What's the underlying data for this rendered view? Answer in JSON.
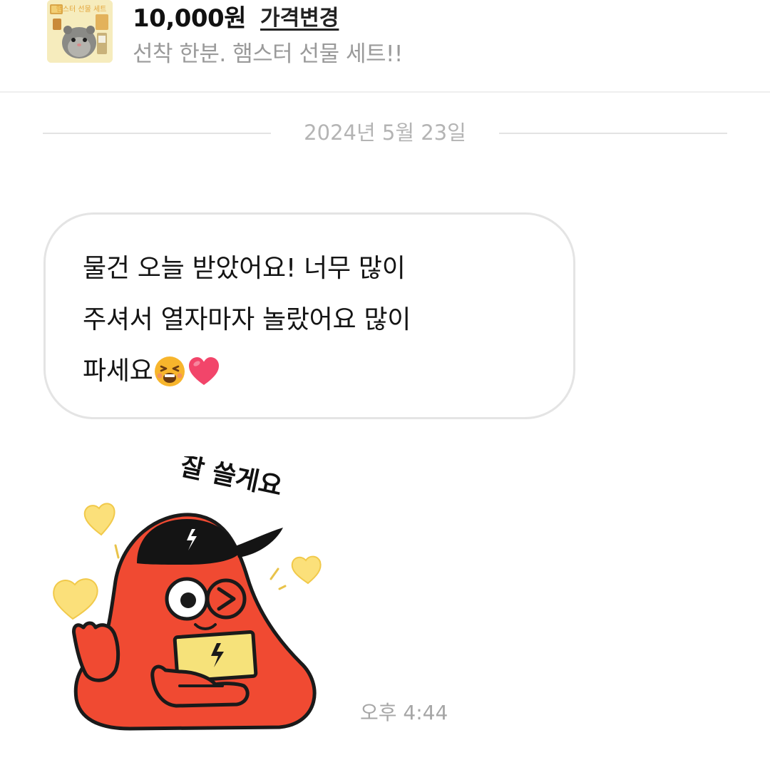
{
  "product": {
    "thumbnail_text": "햄스터 선물 세트",
    "price": "10,000원",
    "price_change_label": "가격변경",
    "description": "선착 한분. 햄스터 선물 세트!!"
  },
  "chat": {
    "date": "2024년 5월 23일",
    "message": {
      "lines": [
        "물건 오늘 받았어요! 너무 많이",
        "주셔서 열자마자 놀랐어요 많이",
        "파세요"
      ],
      "emojis": [
        "tired-face-emoji",
        "red-heart-emoji"
      ]
    },
    "sticker": {
      "caption": "잘 쓸게요",
      "icon": "red-blob-character-sticker"
    },
    "timestamp": "오후 4:44"
  },
  "colors": {
    "divider": "#efefef",
    "bubble_border": "#e4e4e4",
    "muted_text": "#9a9a9a",
    "sticker_red": "#f04a32",
    "heart_yellow": "#fbe07a"
  }
}
